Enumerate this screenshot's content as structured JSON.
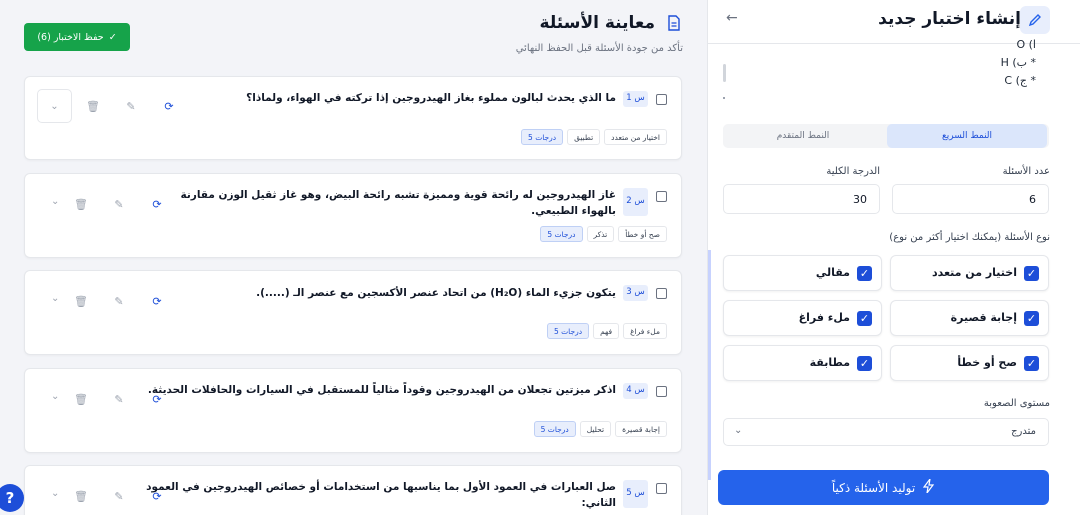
{
  "main": {
    "title": "معاينة الأسئلة",
    "subtitle": "تأكد من جودة الأسئلة قبل الحفظ النهائي",
    "save_button": "حفظ الاختبار (6)",
    "questions": [
      {
        "num": "س 1",
        "text": "ما الذي يحدث لبالون مملوء بغاز الهيدروجين إذا تركته في الهواء، ولماذا؟",
        "tags": [
          "اختيار من متعدد",
          "تطبيق",
          "5 درجات"
        ]
      },
      {
        "num": "س 2",
        "text": "غاز الهيدروجين له رائحة قوية ومميزة تشبه رائحة البيض، وهو غاز ثقيل الوزن مقارنة بالهواء الطبيعي.",
        "tags": [
          "صح أو خطأ",
          "تذكر",
          "5 درجات"
        ]
      },
      {
        "num": "س 3",
        "text": "يتكون جزيء الماء (H₂O) من اتحاد عنصر الأكسجين مع عنصر الـ (.....).",
        "tags": [
          "ملء فراغ",
          "فهم",
          "5 درجات"
        ]
      },
      {
        "num": "س 4",
        "text": "اذكر ميزتين تجعلان من الهيدروجين وقوداً مثالياً للمستقبل في السيارات والحافلات الحديثة.",
        "tags": [
          "إجابة قصيرة",
          "تحليل",
          "5 درجات"
        ]
      },
      {
        "num": "س 5",
        "text": "صل العبارات في العمود الأول بما يناسبها من استخدامات أو خصائص الهيدروجين في العمود الثاني:",
        "tags": []
      }
    ]
  },
  "panel": {
    "title": "إنشاء اختبار جديد",
    "snippet_lines": [
      "ا) O",
      "* ب) H",
      "* ج) C"
    ],
    "mode_quick": "النمط السريع",
    "mode_advanced": "النمط المتقدم",
    "count_label": "عدد الأسئلة",
    "count_value": "6",
    "total_label": "الدرجة الكلية",
    "total_value": "30",
    "types_label": "نوع الأسئلة (يمكنك اختيار أكثر من نوع)",
    "types": [
      "اختيار من متعدد",
      "مقالي",
      "إجابة قصيرة",
      "ملء فراغ",
      "صح أو خطأ",
      "مطابقة"
    ],
    "difficulty_label": "مستوى الصعوبة",
    "difficulty_value": "متدرج",
    "generate_button": "توليد الأسئلة ذكياً"
  },
  "colors": {
    "primary": "#2563eb",
    "success": "#16a34a"
  }
}
